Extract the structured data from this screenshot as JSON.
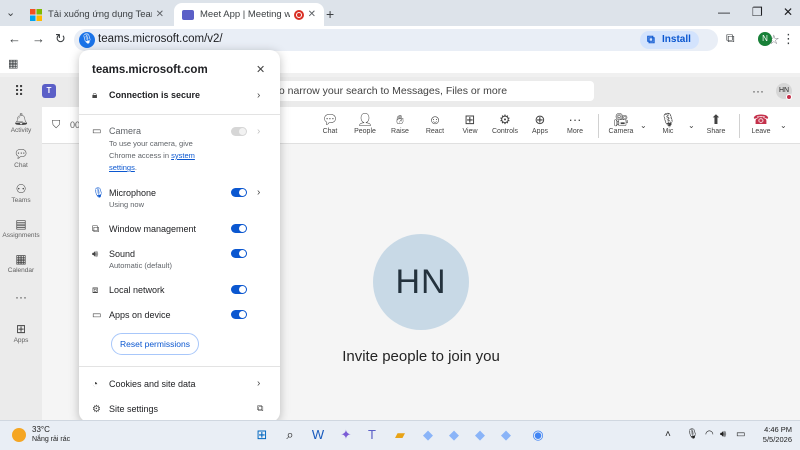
{
  "browser": {
    "tabs": [
      {
        "label": "Tải xuống ứng dụng Teams trên"
      },
      {
        "label": "Meet App | Meeting with H"
      }
    ],
    "url": "teams.microsoft.com/v2/",
    "install_label": "Install",
    "profile_initial": "N"
  },
  "teams": {
    "search_placeholder": "to narrow your search to Messages, Files or more",
    "user_initials": "HN",
    "rail": [
      {
        "label": "Activity",
        "icon": "bell-icon"
      },
      {
        "label": "Chat",
        "icon": "chat-icon"
      },
      {
        "label": "Teams",
        "icon": "teams-icon"
      },
      {
        "label": "Assignments",
        "icon": "assignments-icon"
      },
      {
        "label": "Calendar",
        "icon": "calendar-icon"
      },
      {
        "label": "Apps",
        "icon": "apps-icon"
      }
    ],
    "meeting_timer": "00",
    "controls": [
      {
        "label": "Chat",
        "icon": "chat-icon"
      },
      {
        "label": "People",
        "icon": "people-icon"
      },
      {
        "label": "Raise",
        "icon": "hand-icon"
      },
      {
        "label": "React",
        "icon": "smile-icon"
      },
      {
        "label": "View",
        "icon": "grid-icon"
      },
      {
        "label": "Controls",
        "icon": "controls-icon"
      },
      {
        "label": "Apps",
        "icon": "plus-icon"
      },
      {
        "label": "More",
        "icon": "more-icon"
      },
      {
        "label": "Camera",
        "icon": "camera-off-icon"
      },
      {
        "label": "Mic",
        "icon": "mic-off-icon"
      },
      {
        "label": "Share",
        "icon": "share-icon"
      },
      {
        "label": "Leave",
        "icon": "phone-hangup-icon"
      }
    ],
    "stage_initials": "HN",
    "invite_text": "Invite people to join you"
  },
  "site_info": {
    "title": "teams.microsoft.com",
    "connection": "Connection is secure",
    "camera": {
      "label": "Camera",
      "sub1": "To use your camera, give",
      "sub2": "Chrome access in",
      "link1": "system",
      "link2": "settings",
      "tail": ".",
      "enabled": false
    },
    "microphone": {
      "label": "Microphone",
      "sub": "Using now",
      "enabled": true
    },
    "window_management": {
      "label": "Window management",
      "enabled": true
    },
    "sound": {
      "label": "Sound",
      "sub": "Automatic (default)",
      "enabled": true
    },
    "local_network": {
      "label": "Local network",
      "enabled": true
    },
    "apps_on_device": {
      "label": "Apps on device",
      "enabled": true
    },
    "reset_label": "Reset permissions",
    "cookies": "Cookies and site data",
    "site_settings": "Site settings"
  },
  "taskbar": {
    "temperature": "33°C",
    "condition": "Nắng rải rác",
    "time": "4:46 PM",
    "date": "5/5/2026"
  },
  "colors": {
    "accent": "#0b57d0",
    "teams_purple": "#5b5fc7",
    "leave_red": "#c4314b",
    "avatar_bg": "#c8d9e6"
  }
}
